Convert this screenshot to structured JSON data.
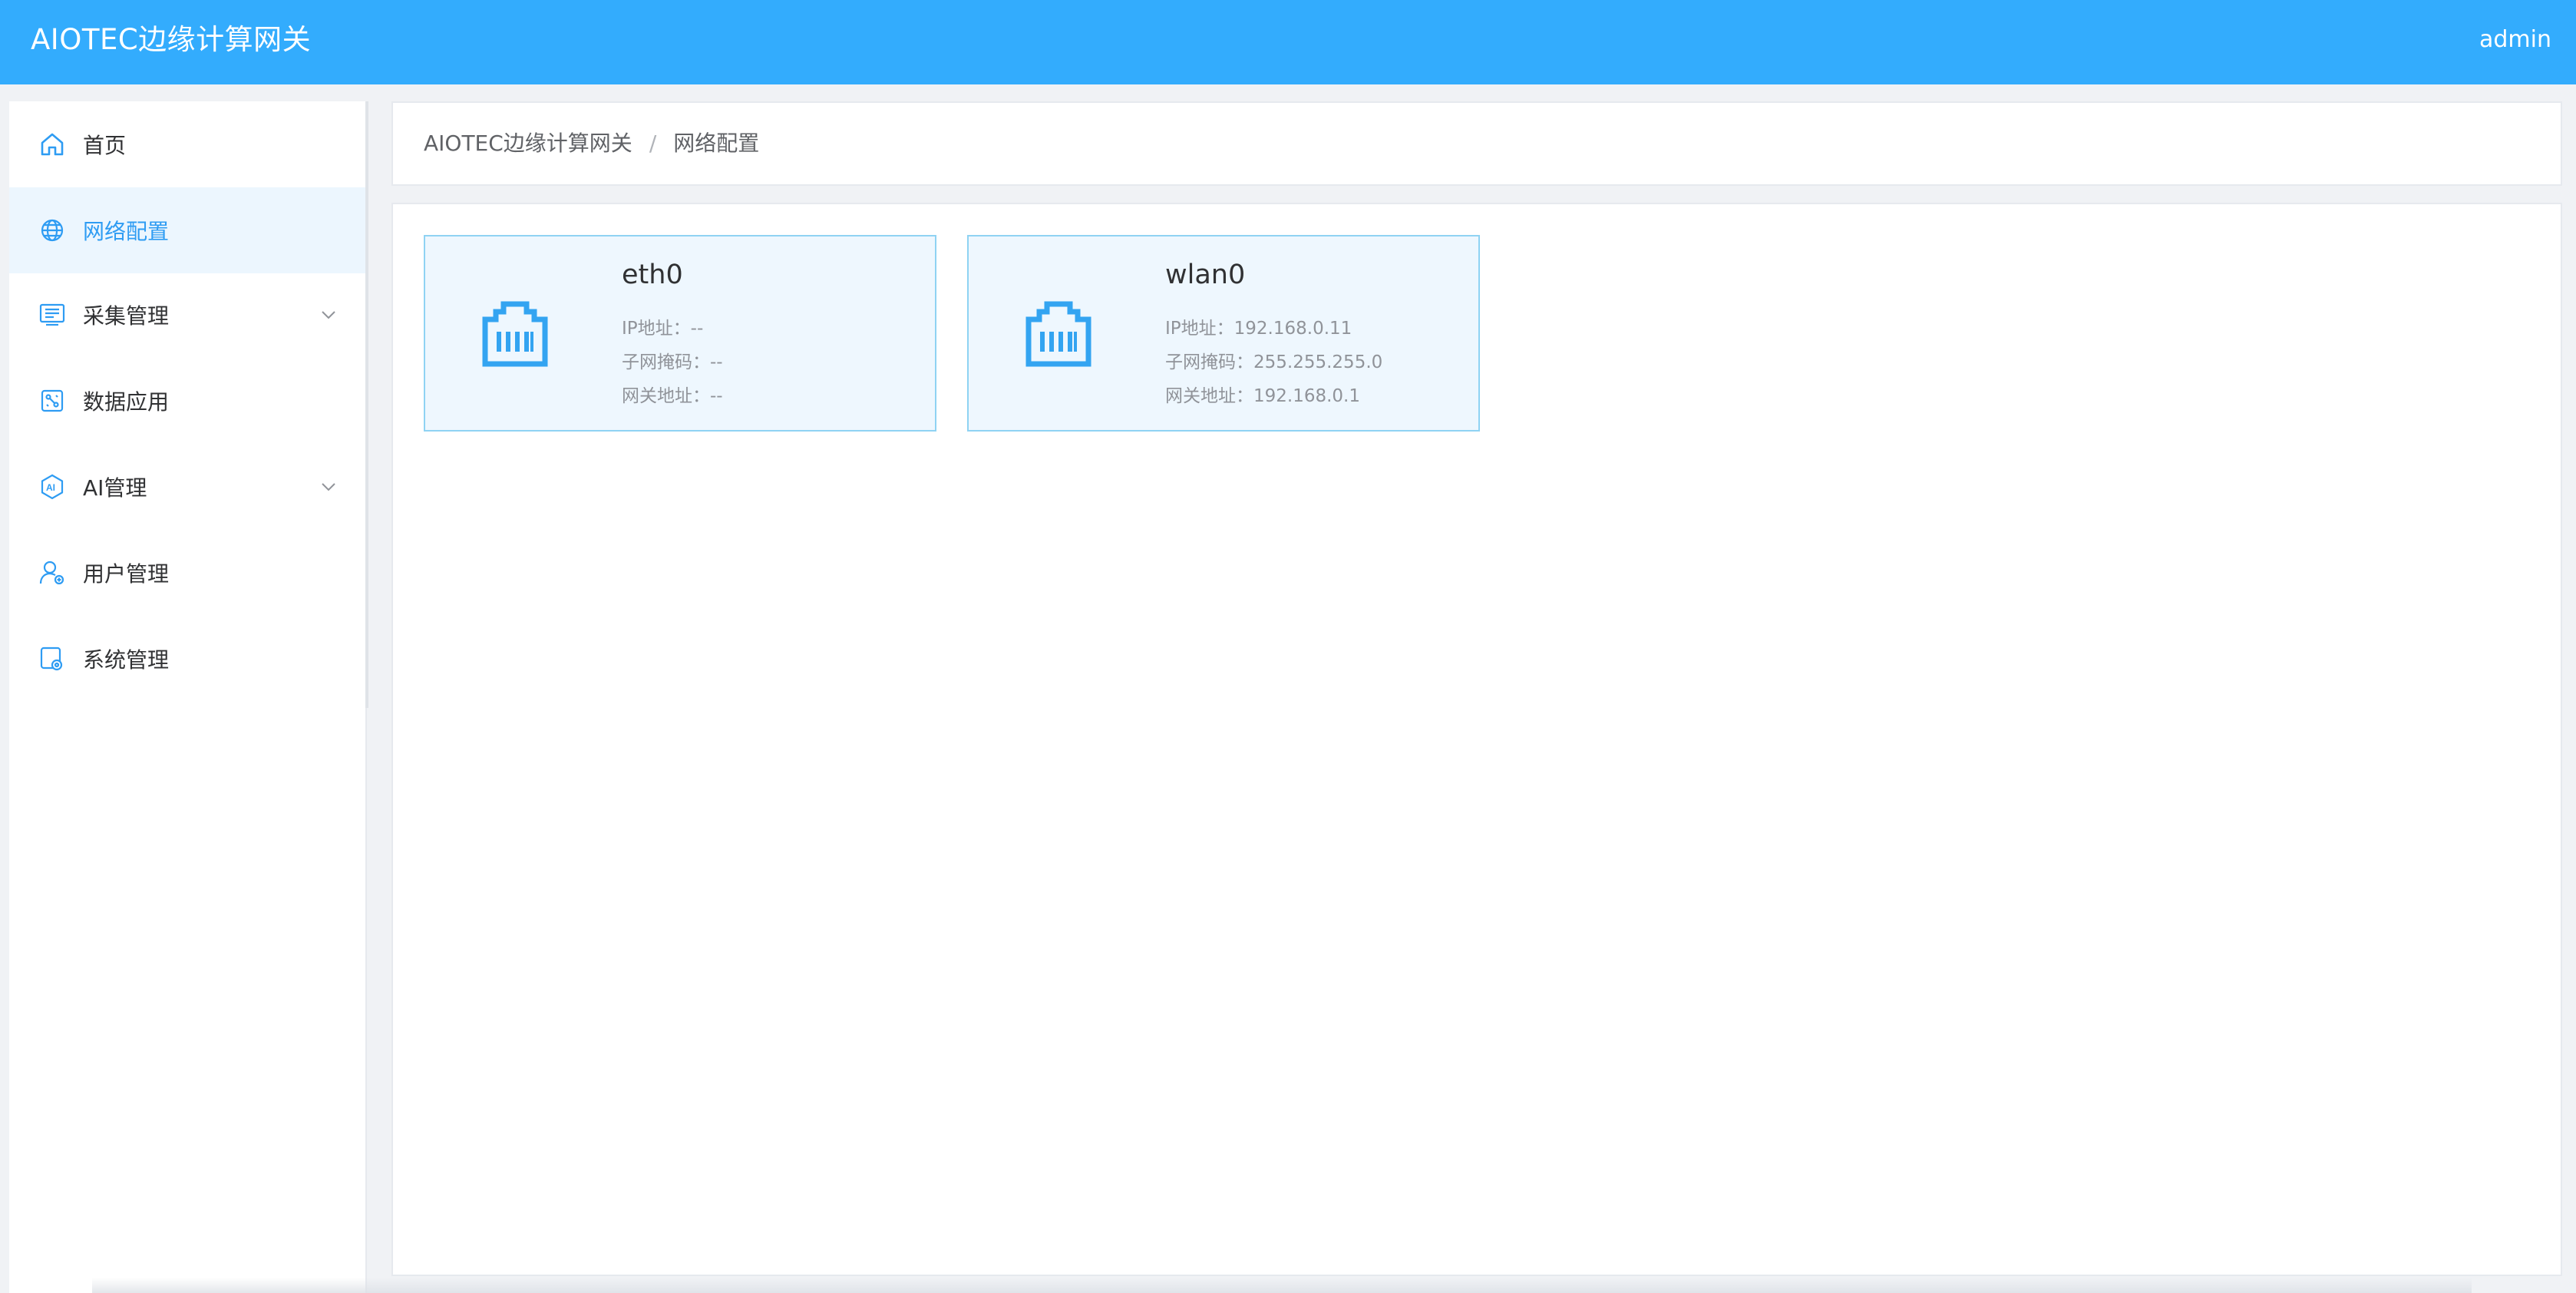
{
  "header": {
    "title": "AIOTEC边缘计算网关",
    "user": "admin"
  },
  "sidebar": {
    "items": [
      {
        "label": "首页",
        "icon": "home-icon"
      },
      {
        "label": "网络配置",
        "icon": "globe-icon",
        "active": true
      },
      {
        "label": "采集管理",
        "icon": "collect-icon",
        "has_submenu": true
      },
      {
        "label": "数据应用",
        "icon": "data-app-icon"
      },
      {
        "label": "AI管理",
        "icon": "ai-icon",
        "has_submenu": true
      },
      {
        "label": "用户管理",
        "icon": "user-icon"
      },
      {
        "label": "系统管理",
        "icon": "system-icon"
      }
    ]
  },
  "breadcrumb": {
    "root": "AIOTEC边缘计算网关",
    "separator": "/",
    "current": "网络配置"
  },
  "interfaces": [
    {
      "name": "eth0",
      "ip_label": "IP地址：",
      "ip": "--",
      "mask_label": "子网掩码：",
      "mask": "--",
      "gateway_label": "网关地址：",
      "gateway": "--"
    },
    {
      "name": "wlan0",
      "ip_label": "IP地址：",
      "ip": "192.168.0.11",
      "mask_label": "子网掩码：",
      "mask": "255.255.255.0",
      "gateway_label": "网关地址：",
      "gateway": "192.168.0.1"
    }
  ],
  "colors": {
    "header_bg": "#33acfd",
    "accent": "#2e9cf3",
    "active_bg": "#ecf6fe",
    "card_bg": "#eef7fe",
    "card_border": "#8fd3f3"
  }
}
